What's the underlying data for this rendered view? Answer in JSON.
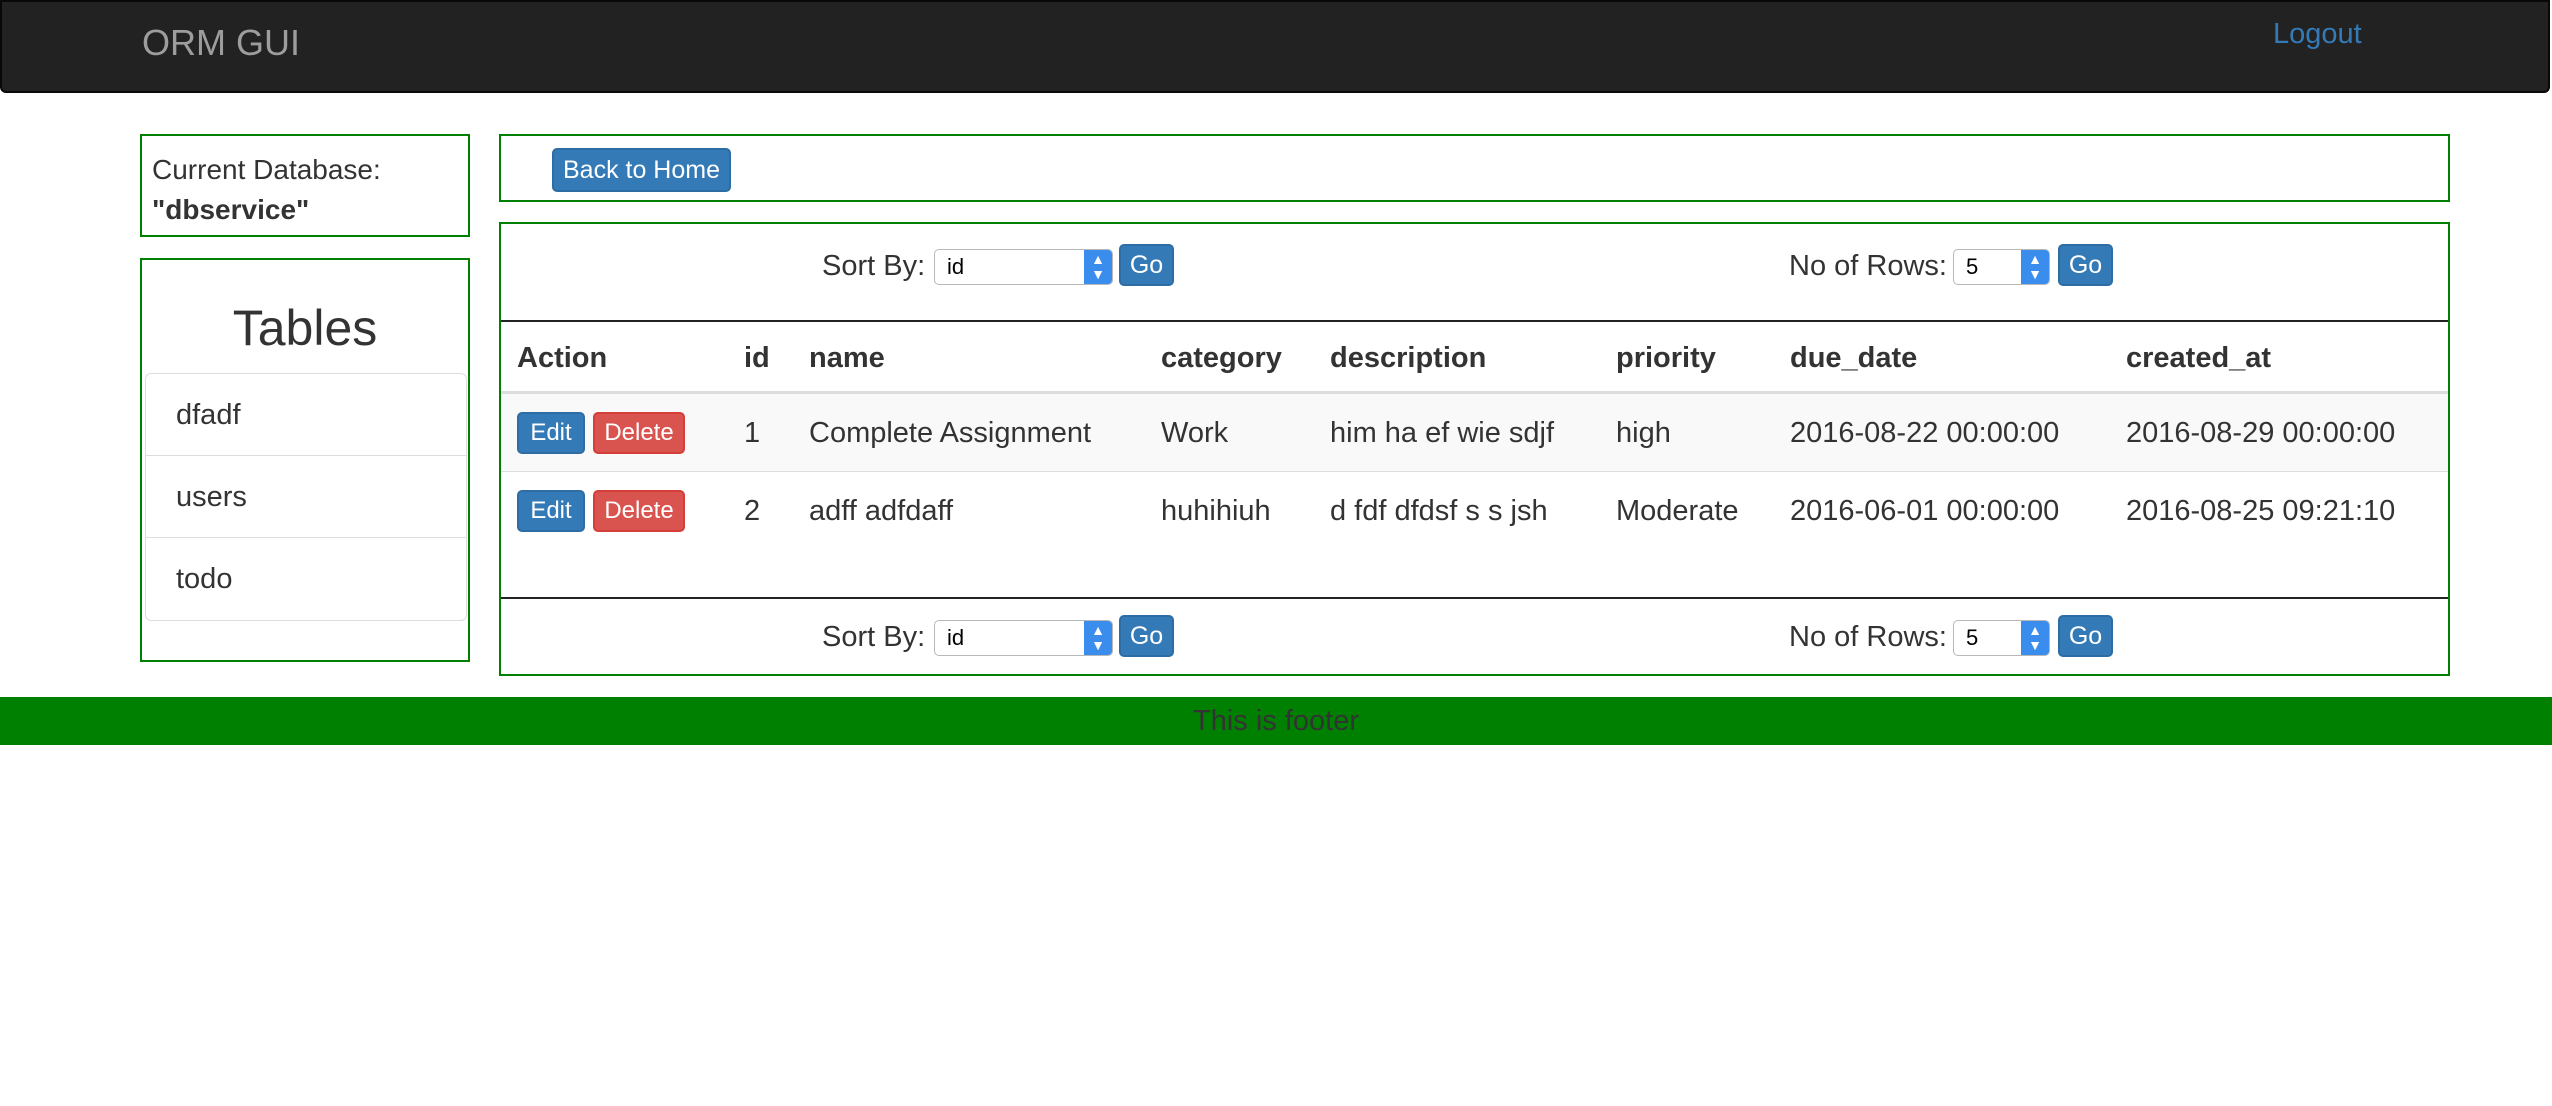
{
  "navbar": {
    "brand": "ORM GUI",
    "logout_label": "Logout"
  },
  "sidebar": {
    "db_label": "Current Database:",
    "db_name": "\"dbservice\"",
    "tables_title": "Tables",
    "tables": [
      {
        "label": "dfadf"
      },
      {
        "label": "users"
      },
      {
        "label": "todo"
      }
    ]
  },
  "toolbar": {
    "back_label": "Back to Home"
  },
  "controls": {
    "sort_label": "Sort By:",
    "sort_value": "id",
    "rows_label": "No of Rows:",
    "rows_value": "5",
    "go_label": "Go",
    "select_arrow": "chevron-up-down-icon"
  },
  "table": {
    "columns": [
      "Action",
      "id",
      "name",
      "category",
      "description",
      "priority",
      "due_date",
      "created_at"
    ],
    "edit_label": "Edit",
    "delete_label": "Delete",
    "rows": [
      {
        "id": "1",
        "name": "Complete Assignment",
        "category": "Work",
        "description": "him ha ef wie sdjf",
        "priority": "high",
        "due_date": "2016-08-22 00:00:00",
        "created_at": "2016-08-29 00:00:00"
      },
      {
        "id": "2",
        "name": "adff adfdaff",
        "category": "huhihiuh",
        "description": "d fdf dfdsf s s jsh",
        "priority": "Moderate",
        "due_date": "2016-06-01 00:00:00",
        "created_at": "2016-08-25 09:21:10"
      }
    ]
  },
  "footer": {
    "text": "This is footer"
  },
  "colors": {
    "navbar_bg": "#222222",
    "brand_text": "#9d9d9d",
    "link": "#337ab7",
    "panel_border": "#008000",
    "btn_primary": "#337ab7",
    "btn_danger": "#d9534f",
    "footer_bg": "#008000"
  }
}
